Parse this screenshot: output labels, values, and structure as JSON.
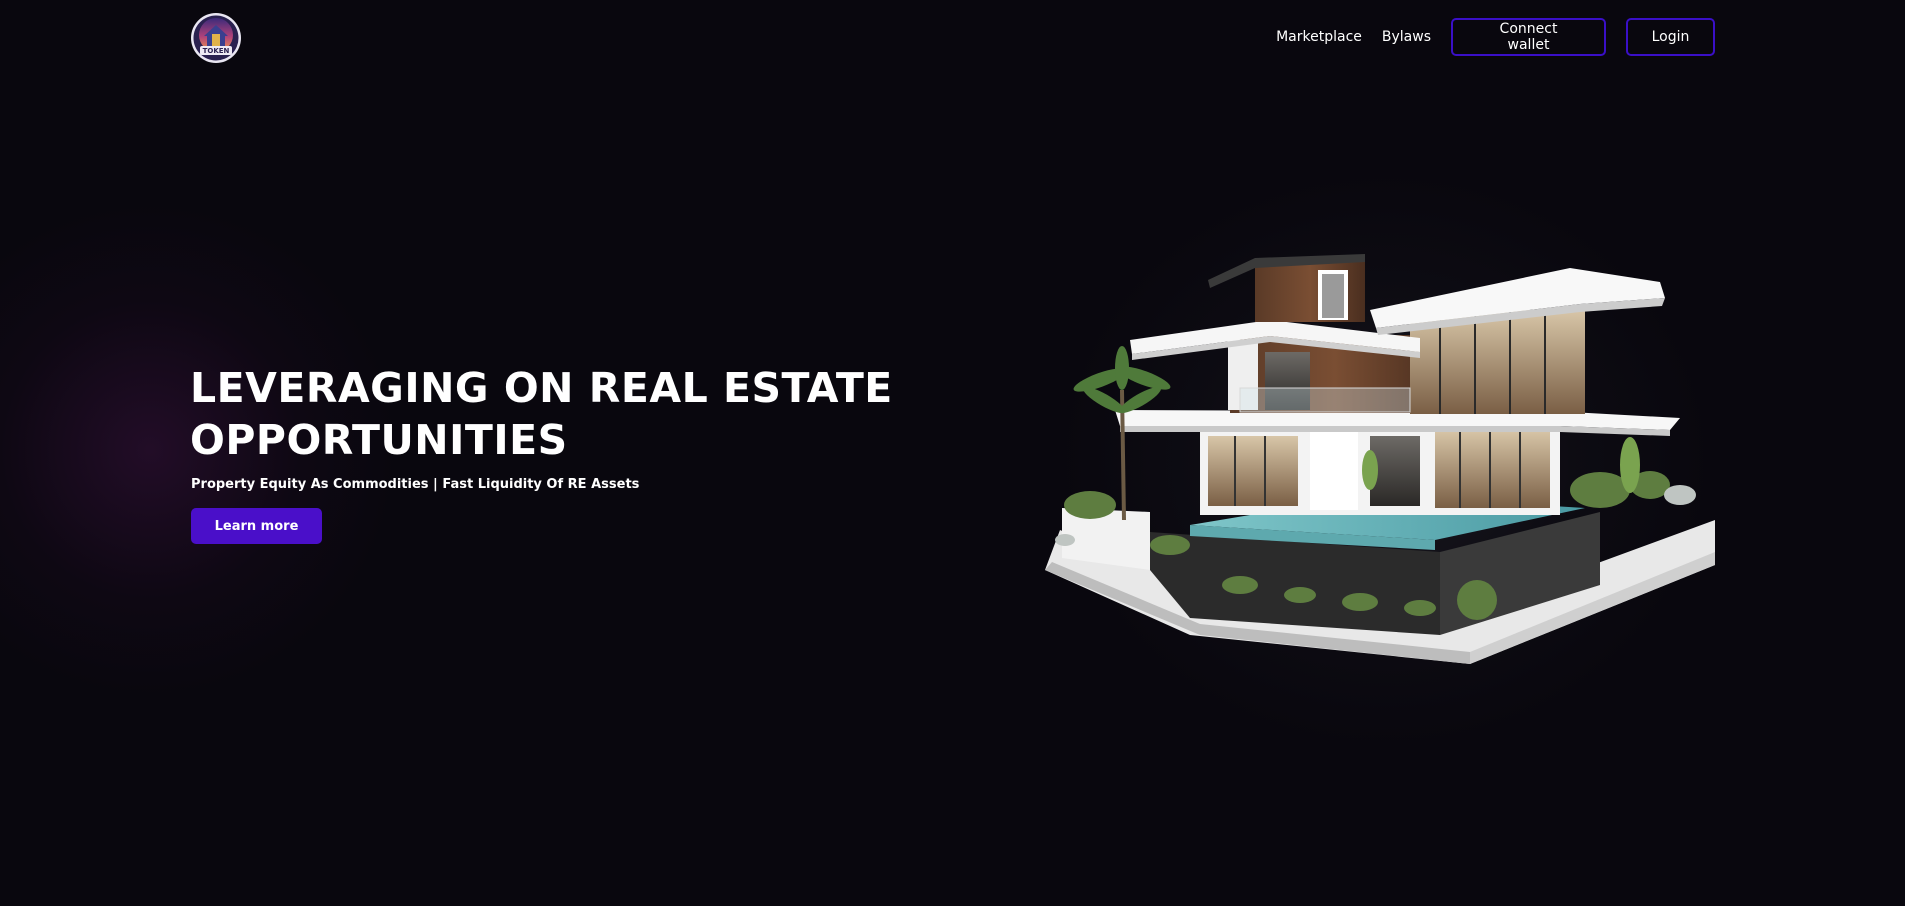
{
  "header": {
    "logo_text": "TOKEN",
    "nav": {
      "marketplace": "Marketplace",
      "bylaws": "Bylaws",
      "connect_wallet": "Connect wallet",
      "login": "Login"
    }
  },
  "hero": {
    "title_line1": "LEVERAGING ON REAL ESTATE",
    "title_line2": "OPPORTUNITIES",
    "subtitle": "Property Equity As Commodities | Fast Liquidity Of RE Assets",
    "cta": "Learn more"
  },
  "colors": {
    "background": "#09070e",
    "accent": "#4a0fc9",
    "button_border": "#3a0fc7"
  },
  "icons": {
    "logo": "house-token-logo",
    "hero_image": "modern-villa-illustration"
  }
}
